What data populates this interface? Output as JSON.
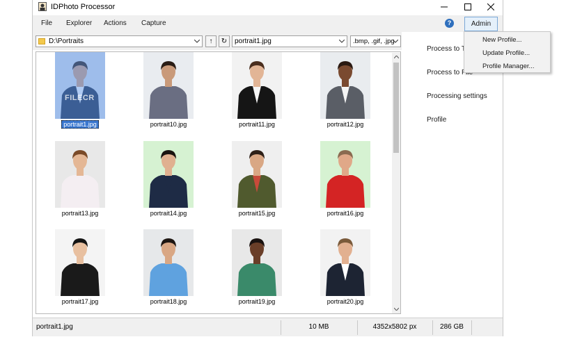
{
  "window": {
    "title": "IDPhoto Processor"
  },
  "menu": {
    "file": "File",
    "explorer": "Explorer",
    "actions": "Actions",
    "capture": "Capture",
    "help": "?",
    "admin": "Admin"
  },
  "toolbar": {
    "folder_path": "D:\\Portraits",
    "up_label": "↑",
    "refresh_label": "↻",
    "file_name": "portrait1.jpg",
    "extensions": ".bmp, .gif, .jpg"
  },
  "gallery": {
    "watermark": "FILECR",
    "thumbs": [
      {
        "label": "portrait1.jpg",
        "bg": "#dfe5ee",
        "suit": "#2b3a52",
        "shirt": "#ffffff",
        "skin": "#d9a784",
        "hair": "#3a2a20",
        "selected": true
      },
      {
        "label": "portrait10.jpg",
        "bg": "#e9ecf0",
        "suit": "#6a6e82",
        "shirt": "#6a6e82",
        "skin": "#c99a7a",
        "hair": "#2a1d16",
        "selected": false
      },
      {
        "label": "portrait11.jpg",
        "bg": "#f2f2f2",
        "suit": "#151515",
        "shirt": "#f5f5f5",
        "skin": "#e2b596",
        "hair": "#4a2e1e",
        "selected": false
      },
      {
        "label": "portrait12.jpg",
        "bg": "#e9ecef",
        "suit": "#5a5e66",
        "shirt": "#f5f5f5",
        "skin": "#7a4a30",
        "hair": "#2a1a12",
        "selected": false
      },
      {
        "label": "portrait13.jpg",
        "bg": "#e8e8e8",
        "suit": "#f4eef2",
        "shirt": "#f4eef2",
        "skin": "#e4b795",
        "hair": "#7a4a28",
        "selected": false
      },
      {
        "label": "portrait14.jpg",
        "bg": "#d6f2d2",
        "suit": "#1e2b45",
        "shirt": "#1e2b45",
        "skin": "#e0b090",
        "hair": "#1a1410",
        "selected": false
      },
      {
        "label": "portrait15.jpg",
        "bg": "#efefef",
        "suit": "#505a2e",
        "shirt": "#c84a3a",
        "skin": "#d9a784",
        "hair": "#2e2018",
        "selected": false
      },
      {
        "label": "portrait16.jpg",
        "bg": "#d6f2d2",
        "suit": "#d42424",
        "shirt": "#d42424",
        "skin": "#e0a888",
        "hair": "#8a6a50",
        "selected": false
      },
      {
        "label": "portrait17.jpg",
        "bg": "#f4f4f4",
        "suit": "#1a1a1a",
        "shirt": "#1a1a1a",
        "skin": "#e8c0a0",
        "hair": "#141414",
        "selected": false
      },
      {
        "label": "portrait18.jpg",
        "bg": "#e6e8ea",
        "suit": "#5fa2df",
        "shirt": "#5fa2df",
        "skin": "#d9a784",
        "hair": "#1e1612",
        "selected": false
      },
      {
        "label": "portrait19.jpg",
        "bg": "#e8e8e8",
        "suit": "#3a8a6a",
        "shirt": "#3a8a6a",
        "skin": "#6a3e28",
        "hair": "#1a1210",
        "selected": false
      },
      {
        "label": "portrait20.jpg",
        "bg": "#f2f2f2",
        "suit": "#1d2433",
        "shirt": "#ffffff",
        "skin": "#e2b090",
        "hair": "#7a5a3a",
        "selected": false
      }
    ]
  },
  "right_panel": {
    "process_to_t": "Process to T",
    "process_to_file": "Process to File",
    "processing_settings": "Processing settings",
    "profile": "Profile"
  },
  "dropdown": {
    "new_profile": "New Profile...",
    "update_profile": "Update Profile...",
    "profile_manager": "Profile Manager..."
  },
  "status": {
    "file": "portrait1.jpg",
    "size": "10 MB",
    "dimensions": "4352x5802 px",
    "disk": "286 GB"
  },
  "colors": {
    "selection": "#3b78d0",
    "admin_border": "#7aa7d6",
    "help": "#2e6fbd"
  }
}
